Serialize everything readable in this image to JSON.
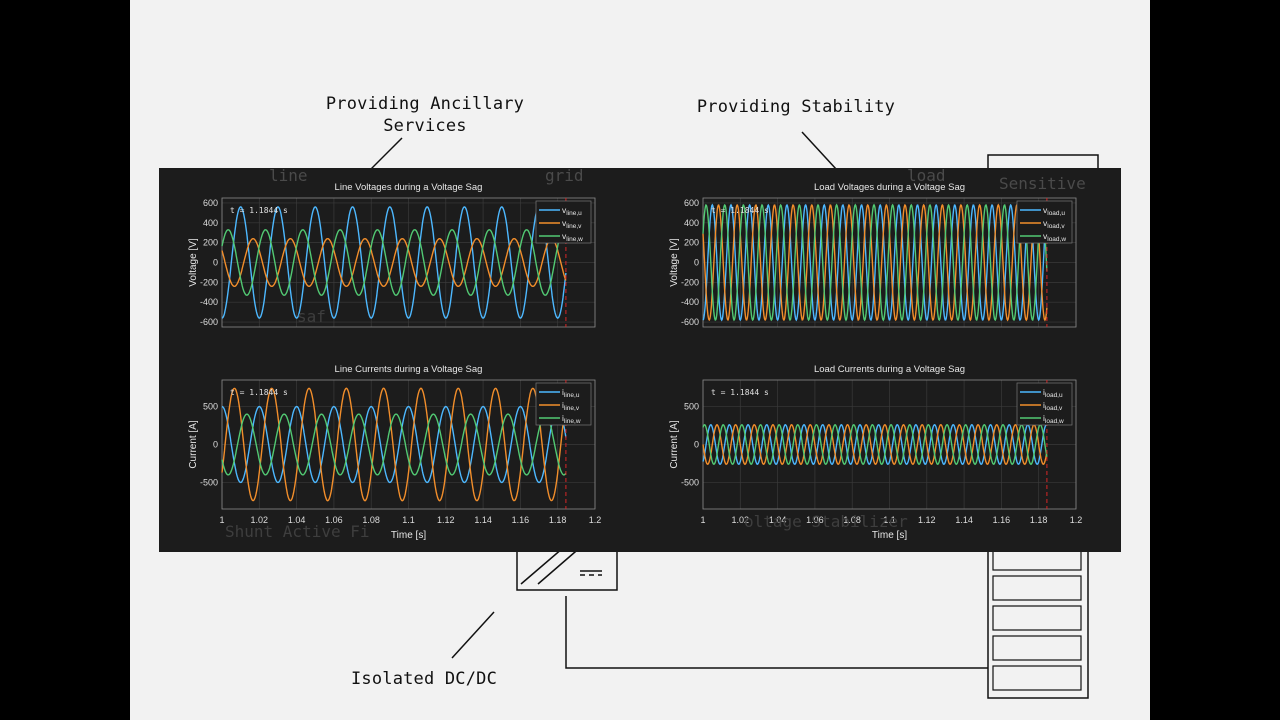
{
  "annotations": {
    "ancillary": [
      "Providing Ancillary",
      "Services"
    ],
    "stability": "Providing Stability",
    "isolated_dcdc": "Isolated DC/DC",
    "background_labels": [
      "line",
      "grid",
      "load",
      "Sensitive",
      "saf",
      "Shunt Active Fi",
      "oltage Stabilizer"
    ]
  },
  "colors": {
    "u": "#4db8ff",
    "v": "#f28e2b",
    "w": "#52c973",
    "cursor": "#d62728",
    "panel_bg": "#1c1c1c"
  },
  "chart_data": [
    {
      "type": "line",
      "title": "Line Voltages during a Voltage Sag",
      "xlabel": "",
      "ylabel": "Voltage  [V]",
      "xlim": [
        1,
        1.2
      ],
      "ylim": [
        -650,
        650
      ],
      "yticks": [
        600,
        400,
        200,
        0,
        -200,
        -400,
        -600
      ],
      "xticks": [],
      "cursor_label": "t = 1.1844  s",
      "cursor_x": 1.1844,
      "legend": "top-right",
      "series": [
        {
          "key": "u",
          "name": "v",
          "sub": "line,u",
          "amplitude": 560,
          "frequency_hz": 50,
          "phase_deg": -90
        },
        {
          "key": "v",
          "name": "v",
          "sub": "line,v",
          "amplitude": 240,
          "frequency_hz": 50,
          "phase_deg": 150
        },
        {
          "key": "w",
          "name": "v",
          "sub": "line,w",
          "amplitude": 330,
          "frequency_hz": 50,
          "phase_deg": 30
        }
      ]
    },
    {
      "type": "line",
      "title": "Load Voltages during a Voltage Sag",
      "xlabel": "",
      "ylabel": "Voltage  [V]",
      "xlim": [
        1,
        1.2
      ],
      "ylim": [
        -650,
        650
      ],
      "yticks": [
        600,
        400,
        200,
        0,
        -200,
        -400,
        -600
      ],
      "xticks": [],
      "cursor_label": "t = 1.1844  s",
      "cursor_x": 1.1844,
      "legend": "top-right",
      "series": [
        {
          "key": "u",
          "name": "v",
          "sub": "load,u",
          "amplitude": 580,
          "frequency_hz": 100,
          "phase_deg": -90
        },
        {
          "key": "v",
          "name": "v",
          "sub": "load,v",
          "amplitude": 580,
          "frequency_hz": 100,
          "phase_deg": 150
        },
        {
          "key": "w",
          "name": "v",
          "sub": "load,w",
          "amplitude": 580,
          "frequency_hz": 100,
          "phase_deg": 30
        }
      ]
    },
    {
      "type": "line",
      "title": "Line Currents during a Voltage Sag",
      "xlabel": "Time  [s]",
      "ylabel": "Current  [A]",
      "xlim": [
        1,
        1.2
      ],
      "ylim": [
        -850,
        850
      ],
      "yticks": [
        500,
        0,
        -500
      ],
      "xticks": [
        "1",
        "1.02",
        "1.04",
        "1.06",
        "1.08",
        "1.1",
        "1.12",
        "1.14",
        "1.16",
        "1.18",
        "1.2"
      ],
      "cursor_label": "t = 1.1844  s",
      "cursor_x": 1.1844,
      "legend": "top-right",
      "series": [
        {
          "key": "u",
          "name": "i",
          "sub": "line,u",
          "amplitude": 500,
          "frequency_hz": 50,
          "phase_deg": 90
        },
        {
          "key": "v",
          "name": "i",
          "sub": "line,v",
          "amplitude": 740,
          "frequency_hz": 50,
          "phase_deg": -30
        },
        {
          "key": "w",
          "name": "i",
          "sub": "line,w",
          "amplitude": 400,
          "frequency_hz": 50,
          "phase_deg": 210
        }
      ]
    },
    {
      "type": "line",
      "title": "Load Currents during a Voltage Sag",
      "xlabel": "Time  [s]",
      "ylabel": "Current  [A]",
      "xlim": [
        1,
        1.2
      ],
      "ylim": [
        -850,
        850
      ],
      "yticks": [
        500,
        0,
        -500
      ],
      "xticks": [
        "1",
        "1.02",
        "1.04",
        "1.06",
        "1.08",
        "1.1",
        "1.12",
        "1.14",
        "1.16",
        "1.18",
        "1.2"
      ],
      "cursor_label": "t = 1.1844  s",
      "cursor_x": 1.1844,
      "legend": "top-right",
      "series": [
        {
          "key": "u",
          "name": "i",
          "sub": "load,u",
          "amplitude": 260,
          "frequency_hz": 100,
          "phase_deg": -60
        },
        {
          "key": "v",
          "name": "i",
          "sub": "load,v",
          "amplitude": 260,
          "frequency_hz": 100,
          "phase_deg": 180
        },
        {
          "key": "w",
          "name": "i",
          "sub": "load,w",
          "amplitude": 260,
          "frequency_hz": 100,
          "phase_deg": 60
        }
      ]
    }
  ]
}
